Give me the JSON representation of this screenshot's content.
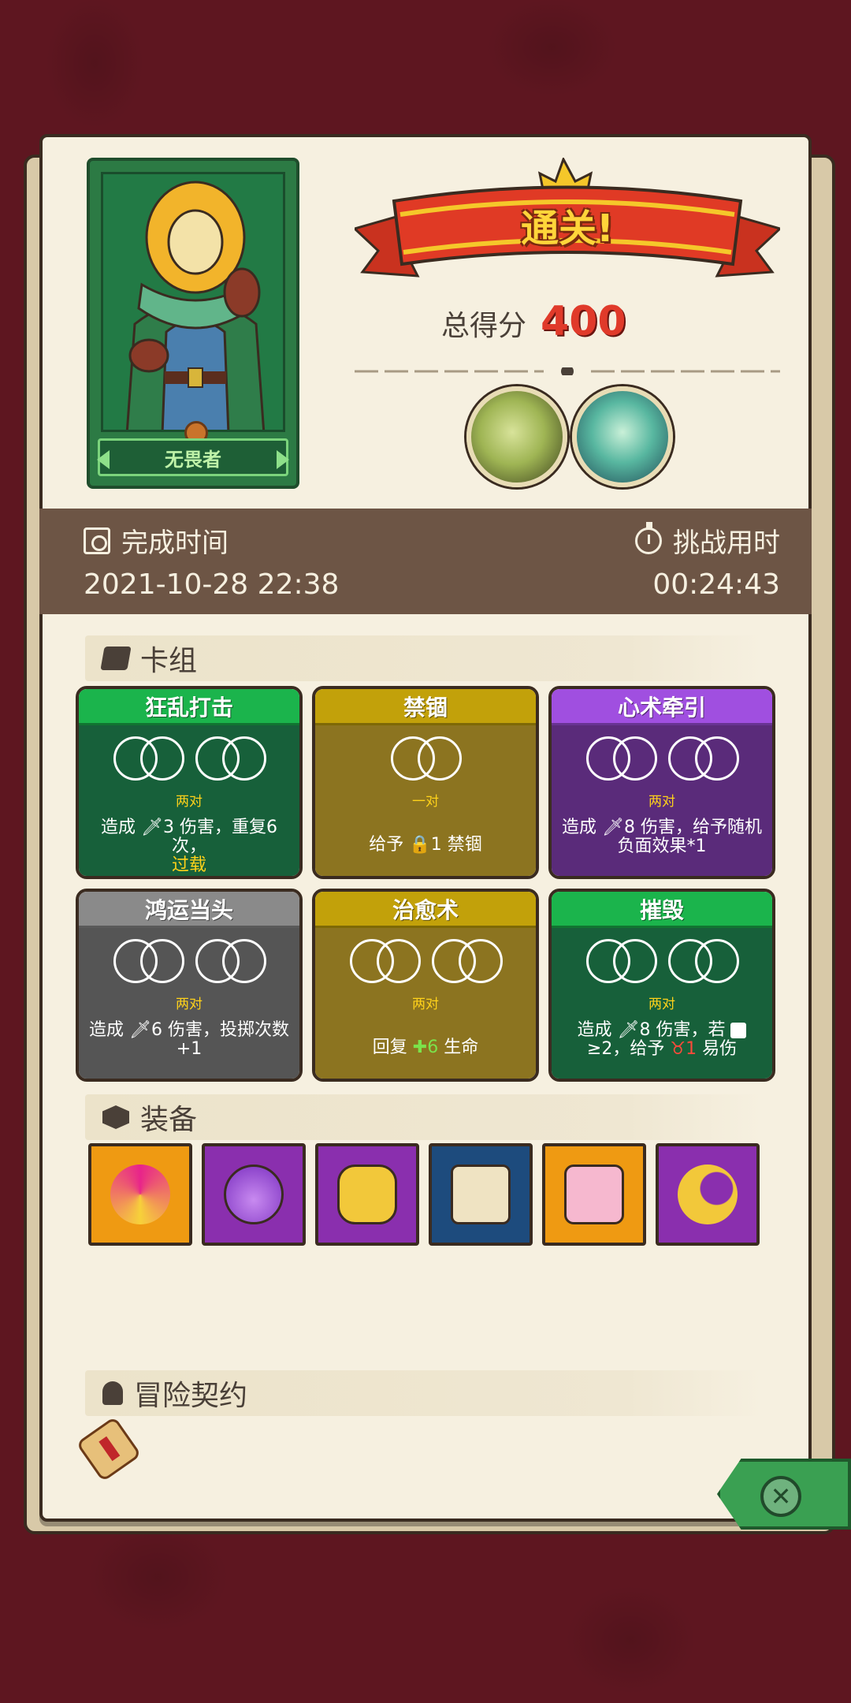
{
  "hero": {
    "name": "无畏者",
    "portrait_icon": "blond-hero-icon",
    "medal_icon": "star-medal-icon"
  },
  "result": {
    "banner": "通关!",
    "score_label": "总得分",
    "score_value": "400"
  },
  "bosses": [
    {
      "icon": "skeleton-dragon-icon"
    },
    {
      "icon": "cyan-beast-icon"
    }
  ],
  "info": {
    "finish_label": "完成时间",
    "finish_value": "2021-10-28 22:38",
    "duration_label": "挑战用时",
    "duration_value": "00:24:43"
  },
  "deck": {
    "title": "卡组",
    "cards": [
      {
        "name": "狂乱打击",
        "combo": "两对",
        "effect_a": "造成 ",
        "effect_b": "3 伤害，重复6次，",
        "effect_c": "过载",
        "color": "#1bb44c"
      },
      {
        "name": "禁锢",
        "combo": "一对",
        "effect_a": "给予 ",
        "effect_b": "1 禁锢",
        "color": "#c2a10a"
      },
      {
        "name": "心术牵引",
        "combo": "两对",
        "effect_a": "造成 ",
        "effect_b": "8 伤害，给予随机负面效果*1",
        "color": "#a04fe0"
      },
      {
        "name": "鸿运当头",
        "combo": "两对",
        "effect_a": "造成 ",
        "effect_b": "6 伤害，投掷次数+1",
        "color": "#8a8a8a"
      },
      {
        "name": "治愈术",
        "combo": "两对",
        "effect_a": "回复 ",
        "effect_b": "6",
        "effect_c": " 生命",
        "color": "#c2a10a"
      },
      {
        "name": "摧毁",
        "combo": "两对",
        "effect_a": "造成 ",
        "effect_b": "8 伤害，若 ",
        "effect_c": "≥2，给予 ",
        "effect_d": "1",
        "effect_e": " 易伤",
        "color": "#1bb44c"
      }
    ]
  },
  "equipment": {
    "title": "装备",
    "items": [
      {
        "icon": "swirl-orb-icon",
        "bg": "#ef9a12"
      },
      {
        "icon": "potion-flask-icon",
        "bg": "#8a2fae"
      },
      {
        "icon": "heart-charm-icon",
        "bg": "#8a2fae"
      },
      {
        "icon": "snowflake-scroll-icon",
        "bg": "#1d4b7d"
      },
      {
        "icon": "heart-box-icon",
        "bg": "#ef9a12"
      },
      {
        "icon": "moon-star-wand-icon",
        "bg": "#8a2fae"
      }
    ]
  },
  "contract": {
    "title": "冒险契约",
    "item_icon": "rolled-scroll-icon"
  },
  "close": {
    "label": "✕",
    "icon": "close-icon"
  }
}
